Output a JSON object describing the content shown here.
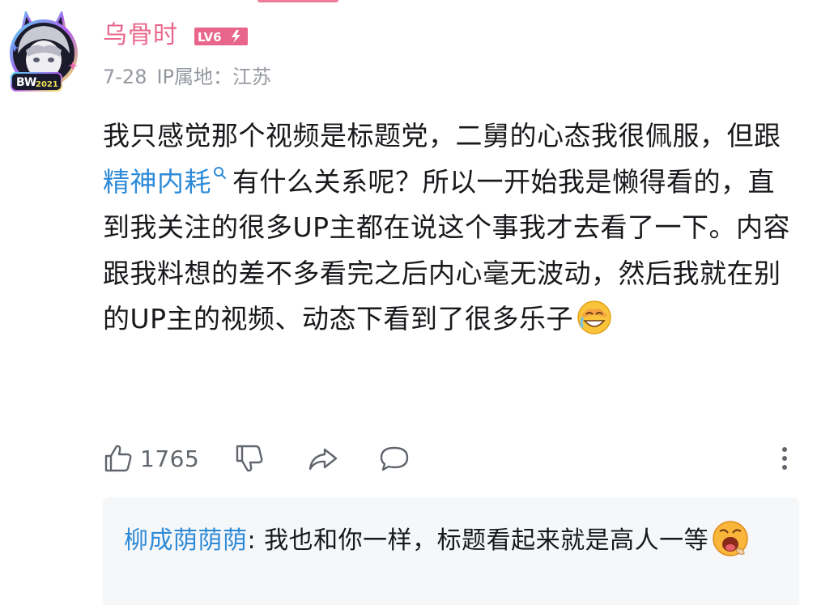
{
  "comment": {
    "username": "乌骨时",
    "level": "LV6",
    "avatar_badge": "BW 2021",
    "date": "7-28",
    "ip_location": "IP属地：江苏",
    "text_before_link": "我只感觉那个视频是标题党，二舅的心态我很佩服，但跟",
    "link_text": "精神内耗",
    "text_after_link": "有什么关系呢？所以一开始我是懒得看的，直到我关注的很多UP主都在说这个事我才去看了一下。内容跟我料想的差不多看完之后内心毫无波动，然后我就在别的UP主的视频、动态下看到了很多乐子",
    "end_emoji": "laugh-cry-emoji",
    "like_count": "1765"
  },
  "reply": {
    "username": "柳成荫荫荫",
    "separator": ":",
    "text": " 我也和你一样，标题看起来就是高人一等",
    "end_emoji": "yawn-emoji"
  },
  "colors": {
    "username": "#e8668c",
    "link": "#2e8bd8",
    "meta": "#9499a0",
    "icon": "#61666d",
    "reply_bg": "#f6f7f8",
    "level_badge": "#e8668c"
  },
  "icons": {
    "like": "thumbs-up-icon",
    "dislike": "thumbs-down-icon",
    "share": "share-icon",
    "reply": "comment-icon",
    "more": "more-vertical-icon",
    "search": "search-icon"
  }
}
